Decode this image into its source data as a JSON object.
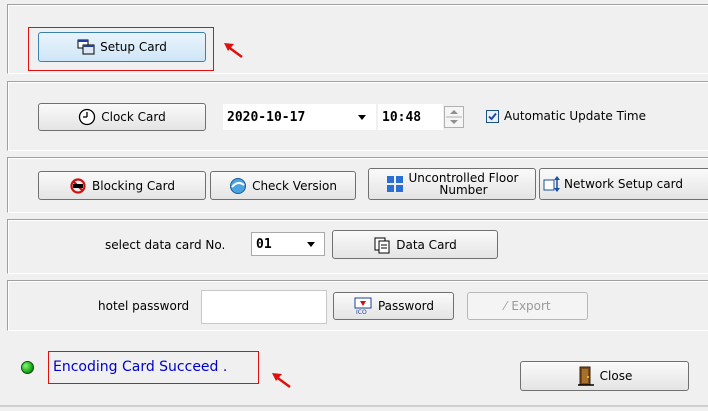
{
  "setup": {
    "setup_card_label": "Setup Card"
  },
  "clock": {
    "clock_card_label": "Clock Card",
    "date_value": "2020-10-17",
    "time_value": "10:48",
    "auto_update_label": "Automatic Update Time",
    "auto_update_checked": true
  },
  "tools": {
    "blocking_card_label": "Blocking Card",
    "check_version_label": "Check Version",
    "uncontrolled_floor_label_line1": "Uncontrolled Floor",
    "uncontrolled_floor_label_line2": "Number",
    "network_setup_label": "Network Setup card"
  },
  "datacard": {
    "select_label": "select data card No.",
    "card_no_value": "01",
    "data_card_label": "Data Card"
  },
  "password": {
    "hotel_password_label": "hotel password",
    "password_value": "",
    "password_button_label": "Password",
    "export_label": "Export"
  },
  "status": {
    "message": "Encoding Card Succeed .",
    "message_color": "#0000cc",
    "led_color": "#1ea81e",
    "close_label": "Close"
  },
  "annotation": {
    "highlight_color": "#e01010"
  }
}
